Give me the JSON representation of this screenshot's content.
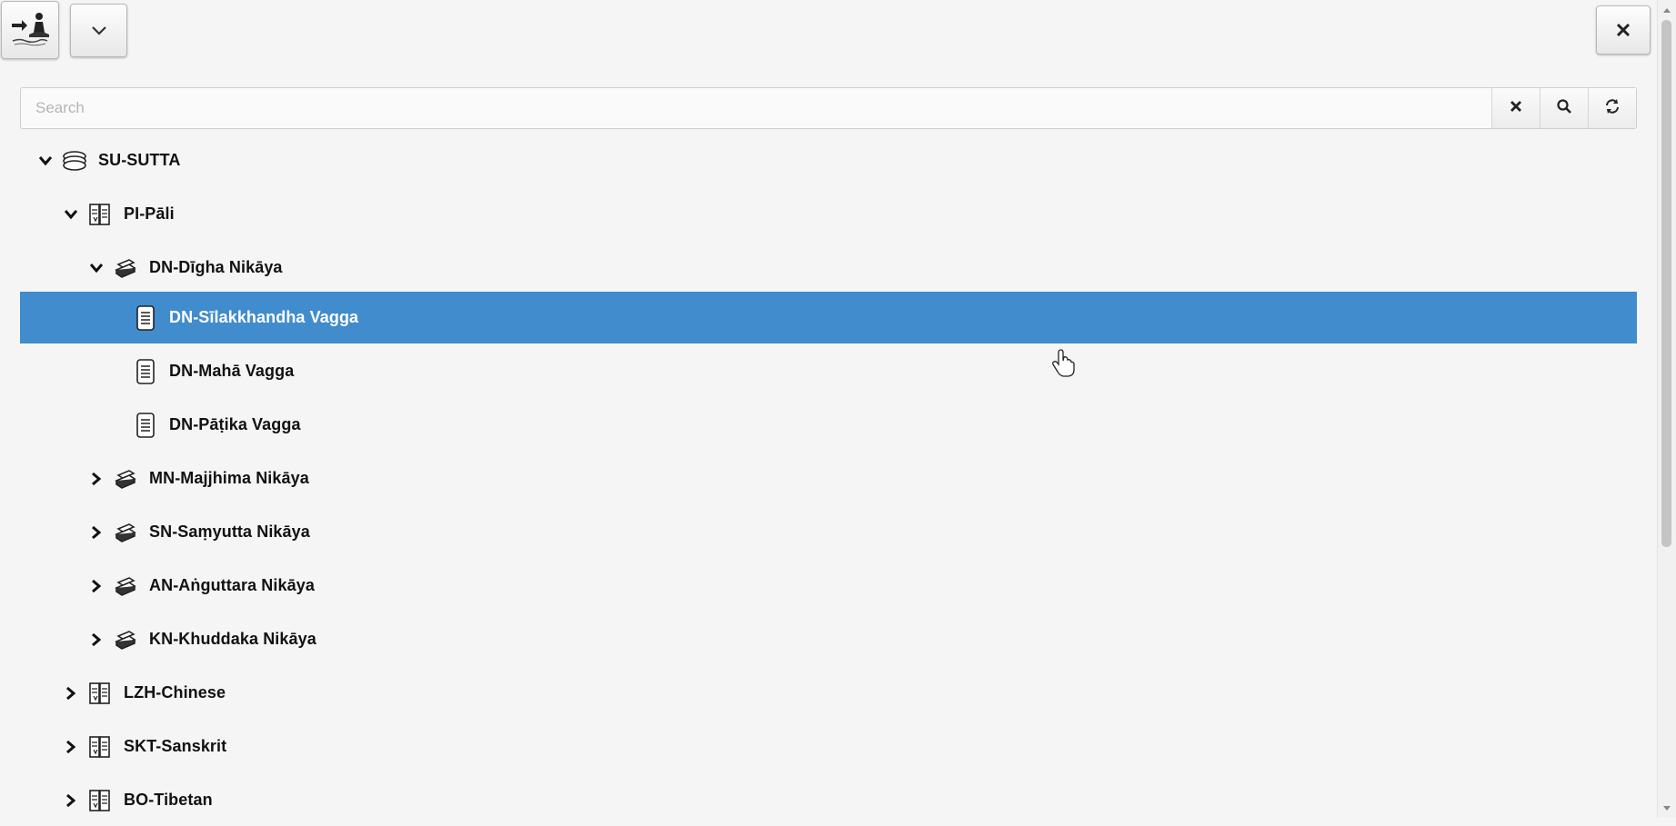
{
  "toolbar": {
    "logo_icon": "meditating-figure-logo-icon",
    "dropdown_icon": "chevron-down-icon",
    "close_icon": "close-icon"
  },
  "search": {
    "placeholder": "Search",
    "value": "",
    "clear_icon": "clear-x-icon",
    "search_icon": "magnifier-icon",
    "refresh_icon": "refresh-icon"
  },
  "tree": {
    "selected_color": "#418ccc",
    "nodes": [
      {
        "label": "SU-SUTTA",
        "level": 0,
        "state": "expanded",
        "icon": "collection-icon"
      },
      {
        "label": "PI-Pāli",
        "level": 1,
        "state": "expanded",
        "icon": "language-book-icon"
      },
      {
        "label": "DN-Dīgha Nikāya",
        "level": 2,
        "state": "expanded",
        "icon": "books-stack-icon"
      },
      {
        "label": "DN-Sīlakkhandha Vagga",
        "level": 3,
        "state": "leaf",
        "icon": "document-icon",
        "selected": true
      },
      {
        "label": "DN-Mahā Vagga",
        "level": 3,
        "state": "leaf",
        "icon": "document-icon"
      },
      {
        "label": "DN-Pāṭika Vagga",
        "level": 3,
        "state": "leaf",
        "icon": "document-icon"
      },
      {
        "label": "MN-Majjhima Nikāya",
        "level": 2,
        "state": "collapsed",
        "icon": "books-stack-icon"
      },
      {
        "label": "SN-Saṃyutta Nikāya",
        "level": 2,
        "state": "collapsed",
        "icon": "books-stack-icon"
      },
      {
        "label": "AN-Aṅguttara Nikāya",
        "level": 2,
        "state": "collapsed",
        "icon": "books-stack-icon"
      },
      {
        "label": "KN-Khuddaka Nikāya",
        "level": 2,
        "state": "collapsed",
        "icon": "books-stack-icon"
      },
      {
        "label": "LZH-Chinese",
        "level": 1,
        "state": "collapsed",
        "icon": "language-book-icon"
      },
      {
        "label": "SKT-Sanskrit",
        "level": 1,
        "state": "collapsed",
        "icon": "language-book-icon"
      },
      {
        "label": "BO-Tibetan",
        "level": 1,
        "state": "collapsed",
        "icon": "language-book-icon"
      }
    ]
  }
}
